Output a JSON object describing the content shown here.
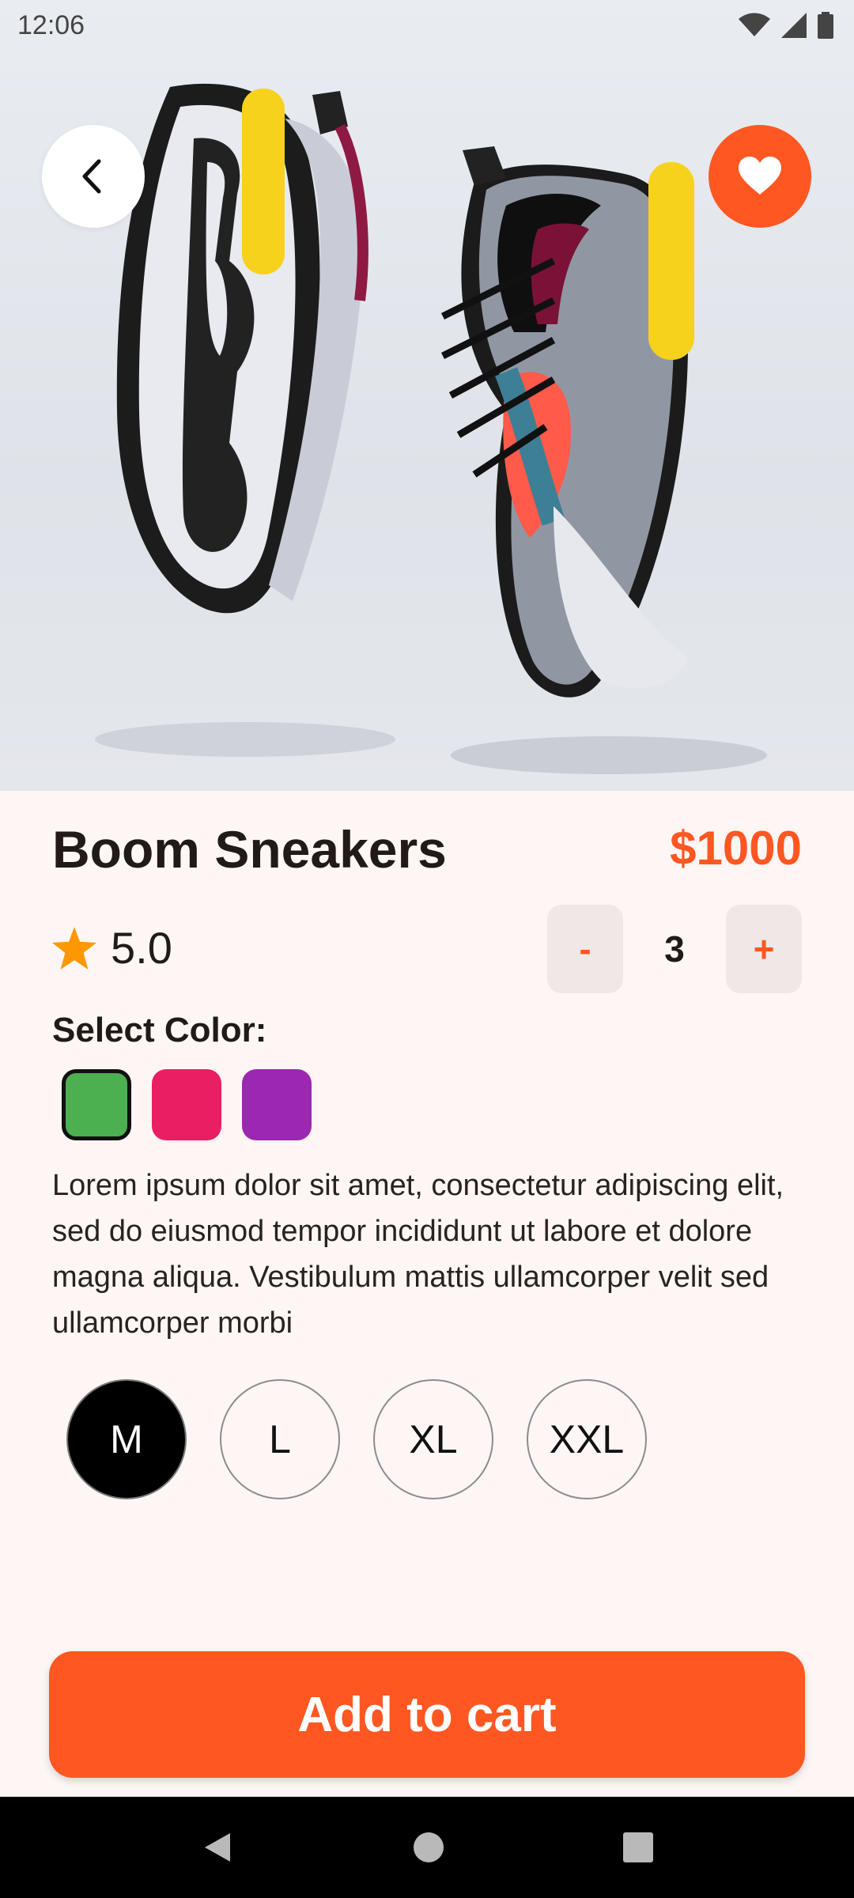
{
  "status_bar": {
    "time": "12:06"
  },
  "product": {
    "name": "Boom Sneakers",
    "price": "$1000",
    "rating": "5.0",
    "quantity": "3",
    "qty_minus": "-",
    "qty_plus": "+",
    "color_label": "Select Color:",
    "colors": [
      "#4caf50",
      "#e91e63",
      "#9c27b0"
    ],
    "selected_color": "#4caf50",
    "description": "Lorem ipsum dolor sit amet, consectetur adipiscing elit, sed do eiusmod tempor incididunt ut labore et dolore magna aliqua. Vestibulum mattis ullamcorper velit sed ullamcorper morbi",
    "sizes": [
      "M",
      "L",
      "XL",
      "XXL"
    ],
    "selected_size": "M"
  },
  "actions": {
    "add_to_cart": "Add to cart"
  },
  "theme": {
    "accent": "#ff5722",
    "background": "#fdf6f4"
  }
}
